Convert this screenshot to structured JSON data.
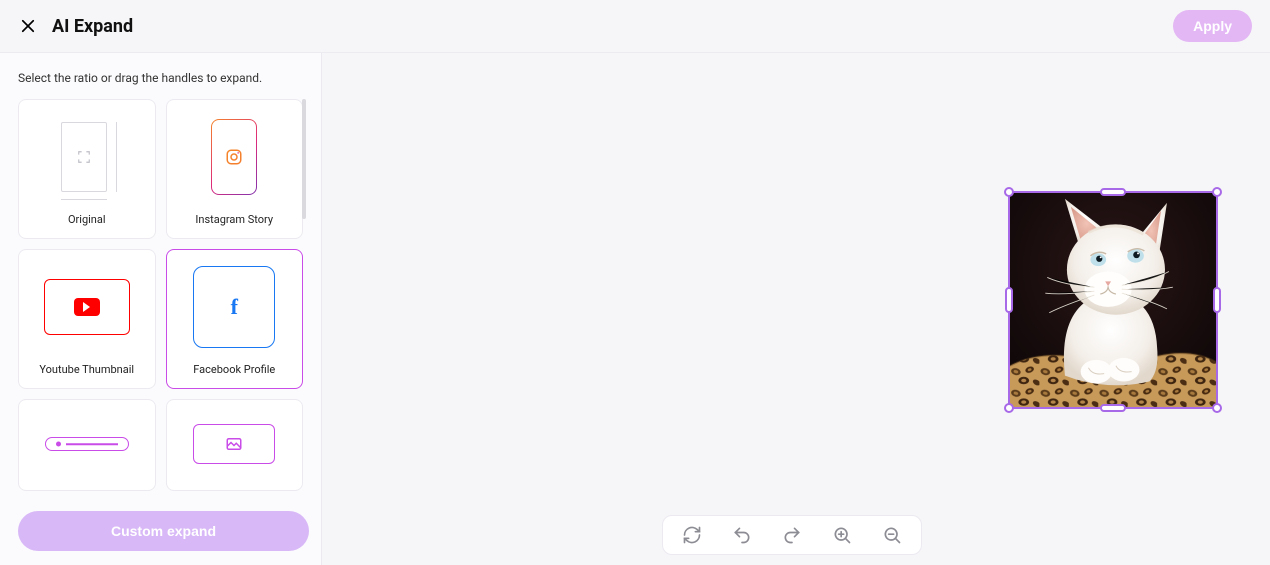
{
  "header": {
    "title": "AI Expand",
    "apply_label": "Apply"
  },
  "sidebar": {
    "instruction": "Select the ratio or drag the handles to expand.",
    "ratios": [
      {
        "label": "Original",
        "icon": "original",
        "selected": false
      },
      {
        "label": "Instagram Story",
        "icon": "instagram-story",
        "selected": false
      },
      {
        "label": "Youtube Thumbnail",
        "icon": "youtube-thumbnail",
        "selected": false
      },
      {
        "label": "Facebook Profile",
        "icon": "facebook-profile",
        "selected": true
      },
      {
        "label": "",
        "icon": "banner",
        "selected": false
      },
      {
        "label": "",
        "icon": "cover",
        "selected": false
      }
    ],
    "custom_expand_label": "Custom expand"
  },
  "toolbar": {
    "icons": [
      "refresh",
      "undo",
      "redo",
      "zoom-in",
      "zoom-out"
    ]
  },
  "canvas": {
    "image_description": "white kitten on leopard-print fabric"
  },
  "colors": {
    "accent": "#c94be8",
    "selection": "#a769e8",
    "apply_bg": "#e3b7f4",
    "custom_bg": "#d8b8f7",
    "youtube": "#ff0000",
    "facebook": "#1877f2"
  }
}
